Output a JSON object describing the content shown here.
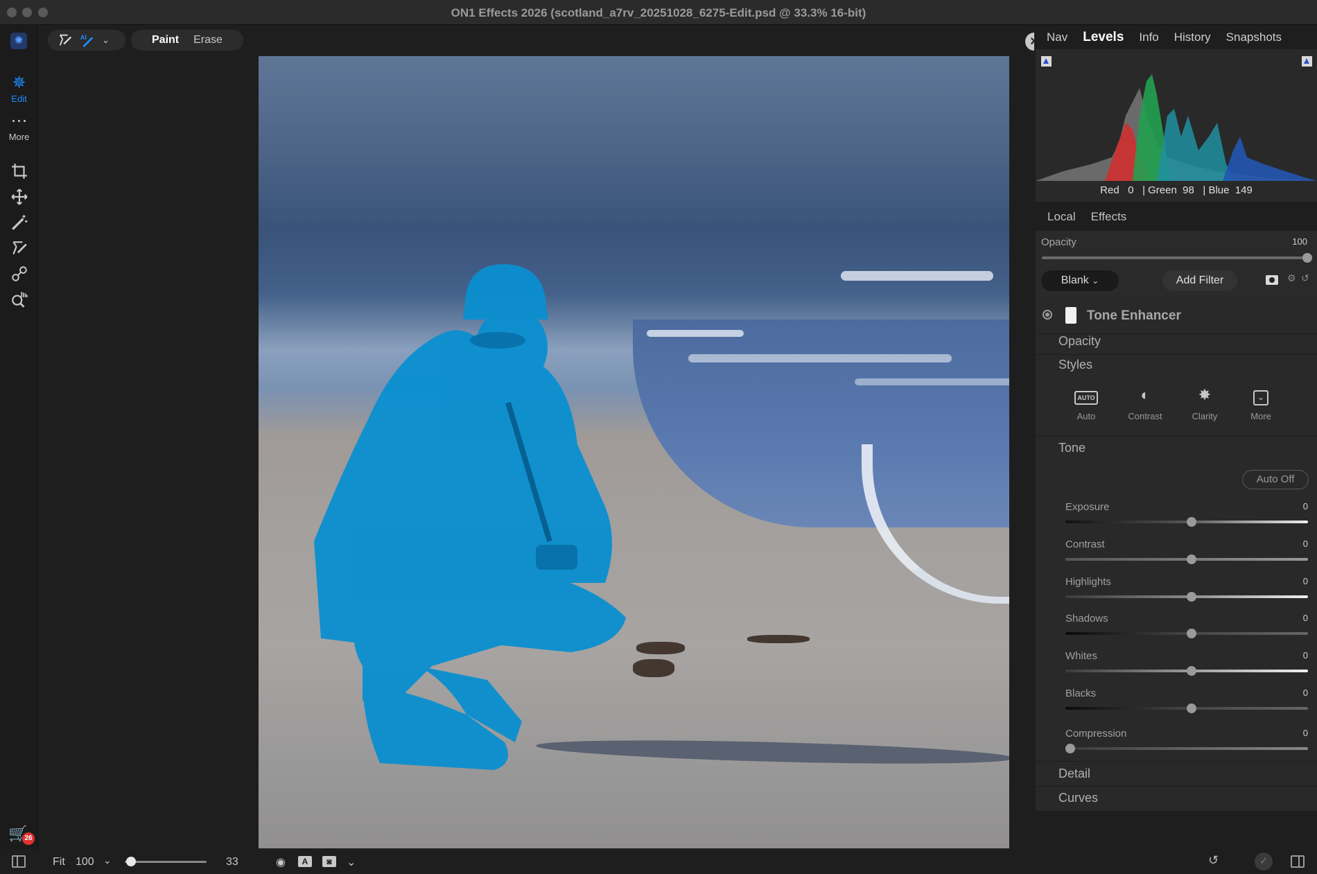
{
  "window": {
    "title": "ON1 Effects 2026 (scotland_a7rv_20251028_6275-Edit.psd @ 33.3% 16-bit)"
  },
  "left_rail": {
    "edit_label": "Edit",
    "more_label": "More",
    "tools": [
      "crop-icon",
      "move-icon",
      "magic-wand-icon",
      "masking-brush-icon",
      "clone-icon",
      "zoom-hand-icon"
    ]
  },
  "toolbar": {
    "paint_label": "Paint",
    "erase_label": "Erase",
    "active_mode": "Paint"
  },
  "bottom_bar": {
    "fit_label": "Fit",
    "zoom_value": "100",
    "brush_size": "33",
    "brush_size_fraction": 0.08,
    "cart_badge": "26"
  },
  "right_panel": {
    "tabs": [
      "Nav",
      "Levels",
      "Info",
      "History",
      "Snapshots"
    ],
    "active_tab": "Levels",
    "histogram": {
      "red_label": "Red",
      "red_value": "0",
      "green_label": "| Green",
      "green_value": "98",
      "blue_label": "| Blue",
      "blue_value": "149"
    },
    "sub_tabs": [
      "Local",
      "Effects"
    ],
    "layer_opacity_label": "Opacity",
    "layer_opacity_value": "100",
    "blank_label": "Blank",
    "add_filter_label": "Add Filter",
    "filter": {
      "title": "Tone Enhancer",
      "opacity_section": "Opacity",
      "styles_section": "Styles",
      "styles": [
        {
          "label": "Auto",
          "icon": "auto-icon"
        },
        {
          "label": "Contrast",
          "icon": "contrast-icon"
        },
        {
          "label": "Clarity",
          "icon": "clarity-icon"
        },
        {
          "label": "More",
          "icon": "more-icon"
        }
      ],
      "tone_section": "Tone",
      "auto_off_label": "Auto Off",
      "sliders": [
        {
          "label": "Exposure",
          "value": "0"
        },
        {
          "label": "Contrast",
          "value": "0"
        },
        {
          "label": "Highlights",
          "value": "0"
        },
        {
          "label": "Shadows",
          "value": "0"
        },
        {
          "label": "Whites",
          "value": "0"
        },
        {
          "label": "Blacks",
          "value": "0"
        },
        {
          "label": "Compression",
          "value": "0"
        }
      ],
      "detail_section": "Detail",
      "curves_section": "Curves"
    }
  },
  "colors": {
    "accent": "#1e7cf0",
    "mask_overlay": "#0a8fd0",
    "badge": "#e0312e"
  }
}
